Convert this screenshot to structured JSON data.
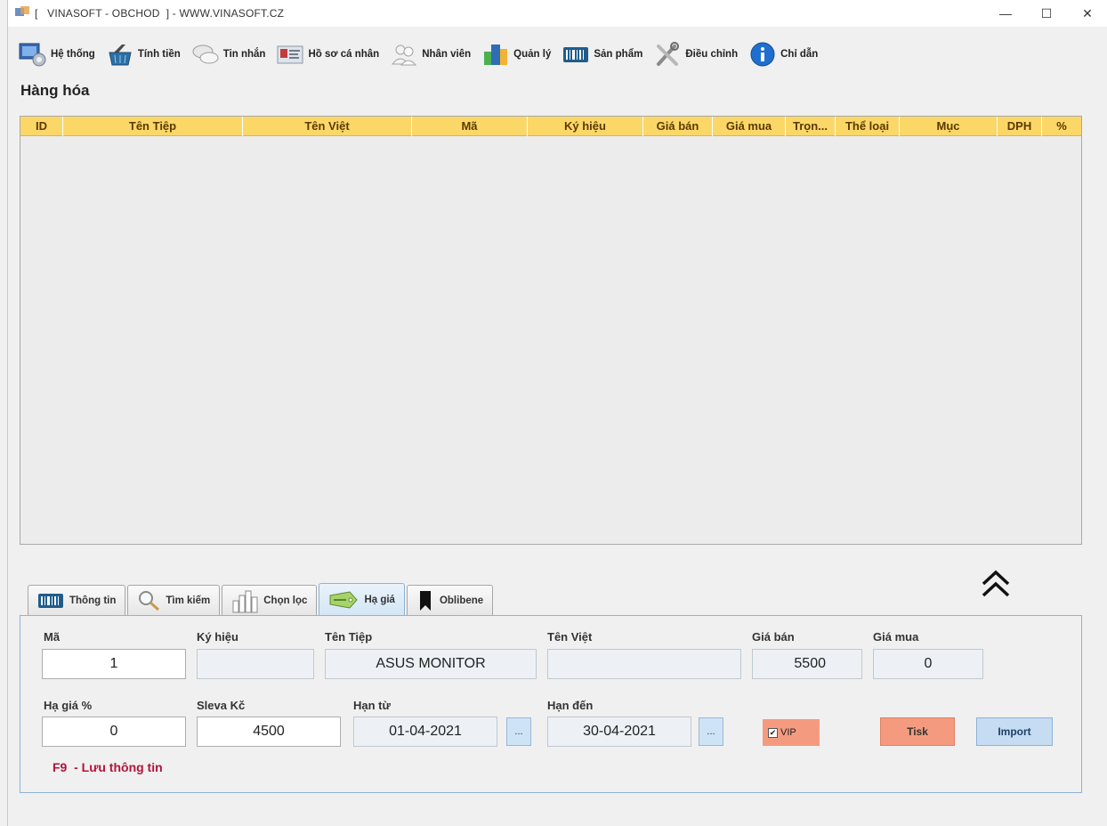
{
  "window": {
    "title": "[   VINASOFT - OBCHOD  ] - WWW.VINASOFT.CZ",
    "controls": {
      "minimize": "—",
      "maximize": "☐",
      "close": "✕"
    }
  },
  "menu": [
    {
      "label": "Hệ thống",
      "icon": "system-settings-icon"
    },
    {
      "label": "Tính tiền",
      "icon": "shopping-basket-icon"
    },
    {
      "label": "Tin nhắn",
      "icon": "chat-bubbles-icon"
    },
    {
      "label": "Hồ sơ cá nhân",
      "icon": "id-card-icon"
    },
    {
      "label": "Nhân viên",
      "icon": "users-icon"
    },
    {
      "label": "Quản lý",
      "icon": "buildings-icon"
    },
    {
      "label": "Sản phẩm",
      "icon": "barcode-icon"
    },
    {
      "label": "Điều chỉnh",
      "icon": "tools-icon"
    },
    {
      "label": "Chỉ dẫn",
      "icon": "info-icon"
    }
  ],
  "section_title": "Hàng hóa",
  "table": {
    "columns": [
      "ID",
      "Tên Tiệp",
      "Tên Việt",
      "Mã",
      "Ký hiệu",
      "Giá bán",
      "Giá mua",
      "Trọn...",
      "Thể loại",
      "Mục",
      "DPH",
      "%"
    ],
    "rows": []
  },
  "tabs": [
    {
      "label": "Thông tin",
      "icon": "barcode-icon",
      "active": false
    },
    {
      "label": "Tìm kiếm",
      "icon": "search-icon",
      "active": false
    },
    {
      "label": "Chọn lọc",
      "icon": "bar-chart-icon",
      "active": false
    },
    {
      "label": "Hạ giá",
      "icon": "discount-tag-icon",
      "active": true
    },
    {
      "label": "Oblibene",
      "icon": "bookmark-icon",
      "active": false
    }
  ],
  "form": {
    "ma": {
      "label": "Mã",
      "value": "1"
    },
    "ky_hieu": {
      "label": "Ký hiệu",
      "value": ""
    },
    "ten_tiep": {
      "label": "Tên Tiệp",
      "value": "ASUS MONITOR"
    },
    "ten_viet": {
      "label": "Tên Việt",
      "value": ""
    },
    "gia_ban": {
      "label": "Giá bán",
      "value": "5500"
    },
    "gia_mua": {
      "label": "Giá mua",
      "value": "0"
    },
    "ha_gia": {
      "label": "Hạ giá %",
      "value": "0"
    },
    "sleva": {
      "label": "Sleva Kč",
      "value": "4500"
    },
    "han_tu": {
      "label": "Hạn từ",
      "value": "01-04-2021",
      "button": "..."
    },
    "han_den": {
      "label": "Hạn đến",
      "value": "30-04-2021",
      "button": "..."
    },
    "vip": {
      "label": "VIP",
      "checked": true,
      "mark": "✔"
    },
    "tisk_button": "Tisk",
    "import_button": "Import",
    "hint": "F9  - Lưu thông tin"
  }
}
